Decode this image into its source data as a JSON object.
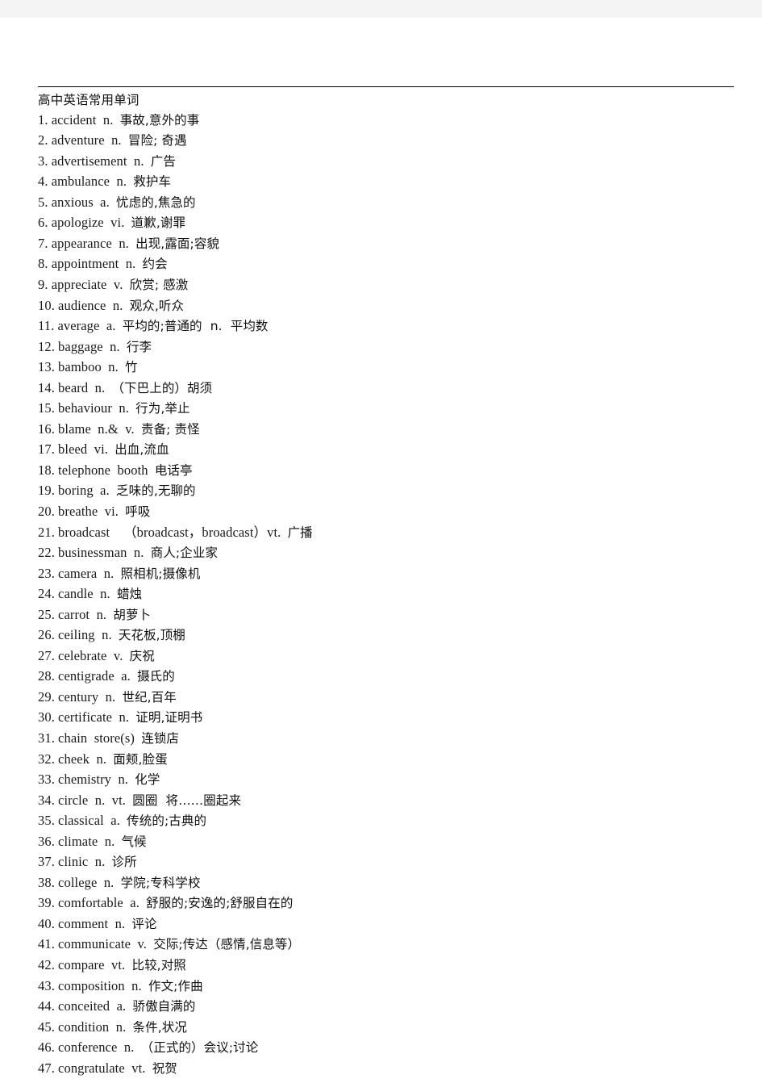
{
  "document": {
    "title": "高中英语常用单词",
    "entries": [
      {
        "num": "1.",
        "english": "accident  n.",
        "chinese": "事故,意外的事"
      },
      {
        "num": "2.",
        "english": "adventure  n.",
        "chinese": "冒险; 奇遇"
      },
      {
        "num": "3.",
        "english": "advertisement  n.",
        "chinese": "广告"
      },
      {
        "num": "4.",
        "english": "ambulance  n.",
        "chinese": "救护车"
      },
      {
        "num": "5.",
        "english": "anxious  a.",
        "chinese": "忧虑的,焦急的"
      },
      {
        "num": "6.",
        "english": "apologize  vi.",
        "chinese": "道歉,谢罪"
      },
      {
        "num": "7.",
        "english": "appearance  n.",
        "chinese": "出现,露面;容貌"
      },
      {
        "num": "8.",
        "english": "appointment  n.",
        "chinese": "约会"
      },
      {
        "num": "9.",
        "english": "appreciate  v.",
        "chinese": "欣赏; 感激"
      },
      {
        "num": "10.",
        "english": "audience  n.",
        "chinese": "观众,听众"
      },
      {
        "num": "11.",
        "english": "average  a.",
        "chinese": "平均的;普通的  n.  平均数"
      },
      {
        "num": "12.",
        "english": "baggage  n.",
        "chinese": "行李"
      },
      {
        "num": "13.",
        "english": "bamboo  n.",
        "chinese": "竹"
      },
      {
        "num": "14.",
        "english": "beard  n.",
        "chinese": "（下巴上的）胡须"
      },
      {
        "num": "15.",
        "english": "behaviour  n.",
        "chinese": "行为,举止"
      },
      {
        "num": "16.",
        "english": "blame  n.&  v.",
        "chinese": "责备; 责怪"
      },
      {
        "num": "17.",
        "english": "bleed  vi.",
        "chinese": "出血,流血"
      },
      {
        "num": "18.",
        "english": "telephone  booth",
        "chinese": "电话亭"
      },
      {
        "num": "19.",
        "english": "boring  a.",
        "chinese": "乏味的,无聊的"
      },
      {
        "num": "20.",
        "english": "breathe  vi.",
        "chinese": "呼吸"
      },
      {
        "num": "21.",
        "english": "broadcast    （broadcast，broadcast）vt.",
        "chinese": "广播"
      },
      {
        "num": "22.",
        "english": "businessman  n.",
        "chinese": "商人;企业家"
      },
      {
        "num": "23.",
        "english": "camera  n.",
        "chinese": "照相机;摄像机"
      },
      {
        "num": "24.",
        "english": "candle  n.",
        "chinese": "蜡烛"
      },
      {
        "num": "25.",
        "english": "carrot  n.",
        "chinese": "胡萝卜"
      },
      {
        "num": "26.",
        "english": "ceiling  n.",
        "chinese": "天花板,顶棚"
      },
      {
        "num": "27.",
        "english": "celebrate  v.",
        "chinese": "庆祝"
      },
      {
        "num": "28.",
        "english": "centigrade  a.",
        "chinese": "摄氏的"
      },
      {
        "num": "29.",
        "english": "century  n.",
        "chinese": "世纪,百年"
      },
      {
        "num": "30.",
        "english": "certificate  n.",
        "chinese": "证明,证明书"
      },
      {
        "num": "31.",
        "english": "chain  store(s)",
        "chinese": "连锁店"
      },
      {
        "num": "32.",
        "english": "cheek  n.",
        "chinese": "面颊,脸蛋"
      },
      {
        "num": "33.",
        "english": "chemistry  n.",
        "chinese": "化学"
      },
      {
        "num": "34.",
        "english": "circle  n.  vt.",
        "chinese": "圆圈  将……圈起来"
      },
      {
        "num": "35.",
        "english": "classical  a.",
        "chinese": "传统的;古典的"
      },
      {
        "num": "36.",
        "english": "climate  n.",
        "chinese": "气候"
      },
      {
        "num": "37.",
        "english": "clinic  n.",
        "chinese": "诊所"
      },
      {
        "num": "38.",
        "english": "college  n.",
        "chinese": "学院;专科学校"
      },
      {
        "num": "39.",
        "english": "comfortable  a.",
        "chinese": "舒服的;安逸的;舒服自在的"
      },
      {
        "num": "40.",
        "english": "comment  n.",
        "chinese": "评论"
      },
      {
        "num": "41.",
        "english": "communicate  v.",
        "chinese": "交际;传达（感情,信息等）"
      },
      {
        "num": "42.",
        "english": "compare  vt.",
        "chinese": "比较,对照"
      },
      {
        "num": "43.",
        "english": "composition  n.",
        "chinese": "作文;作曲"
      },
      {
        "num": "44.",
        "english": "conceited  a.",
        "chinese": "骄傲自满的"
      },
      {
        "num": "45.",
        "english": "condition  n.",
        "chinese": "条件,状况"
      },
      {
        "num": "46.",
        "english": "conference  n.",
        "chinese": "（正式的）会议;讨论"
      },
      {
        "num": "47.",
        "english": "congratulate  vt.",
        "chinese": "祝贺"
      }
    ]
  }
}
